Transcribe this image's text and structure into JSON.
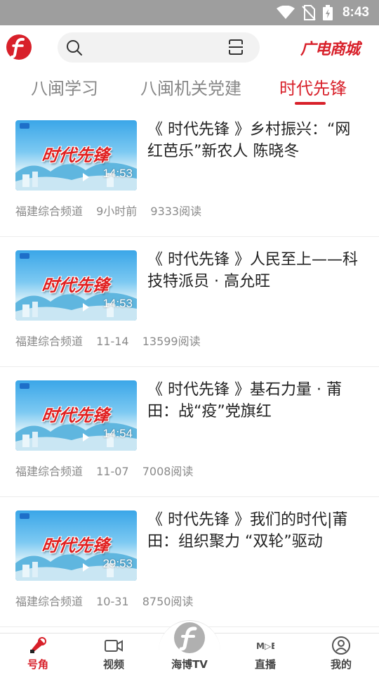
{
  "status_bar": {
    "time": "8:43"
  },
  "header": {
    "mall_label": "广电商城"
  },
  "tabs": [
    {
      "label": "八闽学习",
      "active": false
    },
    {
      "label": "八闽机关党建",
      "active": false
    },
    {
      "label": "时代先锋",
      "active": true
    }
  ],
  "news": [
    {
      "title": "《 时代先锋 》乡村振兴：“网红芭乐”新农人 陈晓冬",
      "thumb_text": "时代先锋",
      "duration": "14:53",
      "source": "福建综合频道",
      "time": "9小时前",
      "reads": "9333阅读"
    },
    {
      "title": "《 时代先锋 》人民至上——科技特派员 · 高允旺",
      "thumb_text": "时代先锋",
      "duration": "14:53",
      "source": "福建综合频道",
      "time": "11-14",
      "reads": "13599阅读"
    },
    {
      "title": "《 时代先锋 》基石力量 · 莆田：战“疫”党旗红",
      "thumb_text": "时代先锋",
      "duration": "14:54",
      "source": "福建综合频道",
      "time": "11-07",
      "reads": "7008阅读"
    },
    {
      "title": "《 时代先锋 》我们的时代|莆田：组织聚力 “双轮”驱动",
      "thumb_text": "时代先锋",
      "duration": "29:53",
      "source": "福建综合频道",
      "time": "10-31",
      "reads": "8750阅读"
    }
  ],
  "bottom_nav": [
    {
      "label": "号角",
      "icon": "horn-icon",
      "active": true
    },
    {
      "label": "视频",
      "icon": "video-camera-icon",
      "active": false
    },
    {
      "label": "海博TV",
      "icon": "haibo-logo-icon",
      "active": false
    },
    {
      "label": "直播",
      "icon": "live-icon",
      "active": false
    },
    {
      "label": "我的",
      "icon": "profile-icon",
      "active": false
    }
  ],
  "colors": {
    "accent": "#d8202a",
    "status_bar": "#9e9e9e",
    "text": "#222222",
    "meta": "#8a8a8a"
  }
}
